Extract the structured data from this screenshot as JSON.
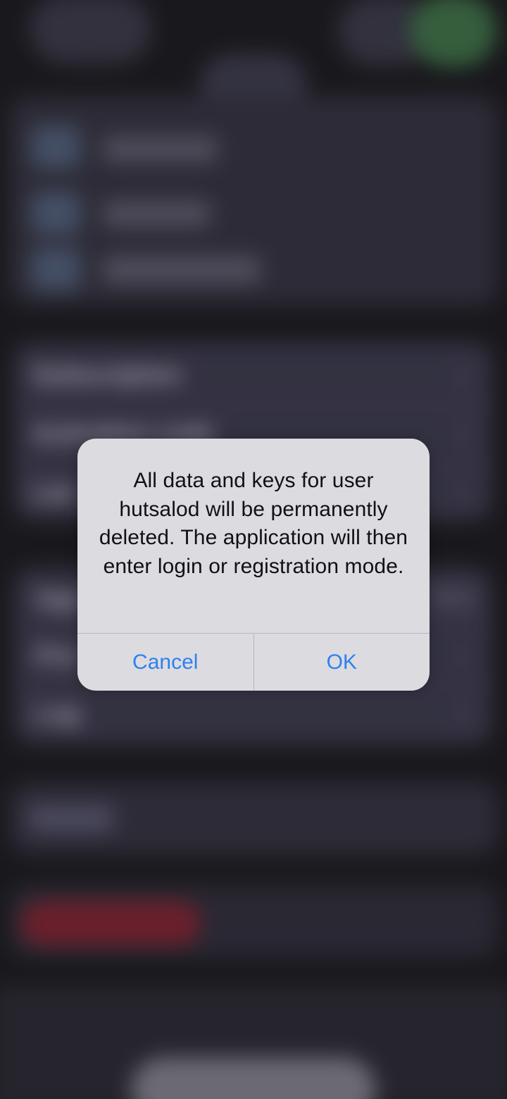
{
  "background": {
    "settings_rows": [
      {
        "label": "Subscription"
      },
      {
        "label": "Activation code"
      },
      {
        "label": "Lan"
      },
      {
        "label": "App",
        "value": "737)"
      },
      {
        "label": "Priv"
      },
      {
        "label": "Log"
      }
    ]
  },
  "alert": {
    "message": "All data and keys for user hutsalod will be permanently deleted. The application will then enter login or registration mode.",
    "cancel_label": "Cancel",
    "ok_label": "OK"
  },
  "colors": {
    "accent": "#2f80f0",
    "alert_background": "#dcdbe0",
    "destructive_bg": "#7a2433"
  }
}
